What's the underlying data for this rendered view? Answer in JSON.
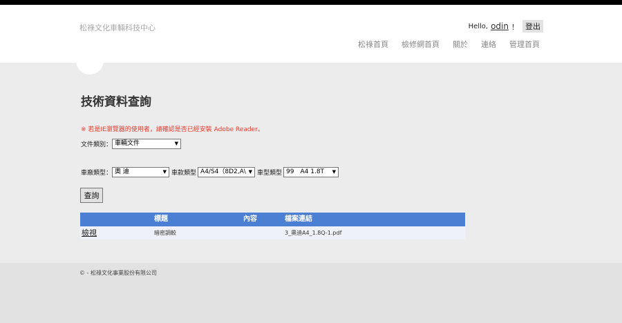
{
  "header": {
    "brand": "松祿文化車輛科技中心",
    "greeting": "Hello,",
    "username": "odin",
    "exclaim": "！",
    "logout": "登出",
    "nav": [
      "松祿首頁",
      "檢修網首頁",
      "關於",
      "連絡",
      "管理首頁"
    ]
  },
  "main": {
    "title": "技術資料查詢",
    "warning": "※ 若是IE瀏覽器的使用者，請確認是否已經安裝 Adobe Reader。",
    "doc_type_label": "文件類別：",
    "doc_type_value": "車輛文件",
    "maker_label": "車廠類型：",
    "maker_value": "奧 迪",
    "model_label": "車款類型",
    "model_value": "A4/S4（8D2,A\\",
    "car_label": "車型類型",
    "car_value": "99　A4 1.8T",
    "query_button": "查詢"
  },
  "table": {
    "headers": [
      "",
      "標題",
      "內容",
      "檔案連結"
    ],
    "rows": [
      {
        "action": "檢視",
        "title": "暗密調較",
        "content": "",
        "file": "3_奧迪A4_1.8Q-1.pdf"
      }
    ]
  },
  "footer": {
    "copyright": "© - 松祿文化事業股份有限公司"
  },
  "colors": {
    "table_header": "#4a7fd3",
    "warning": "#e8392c"
  }
}
